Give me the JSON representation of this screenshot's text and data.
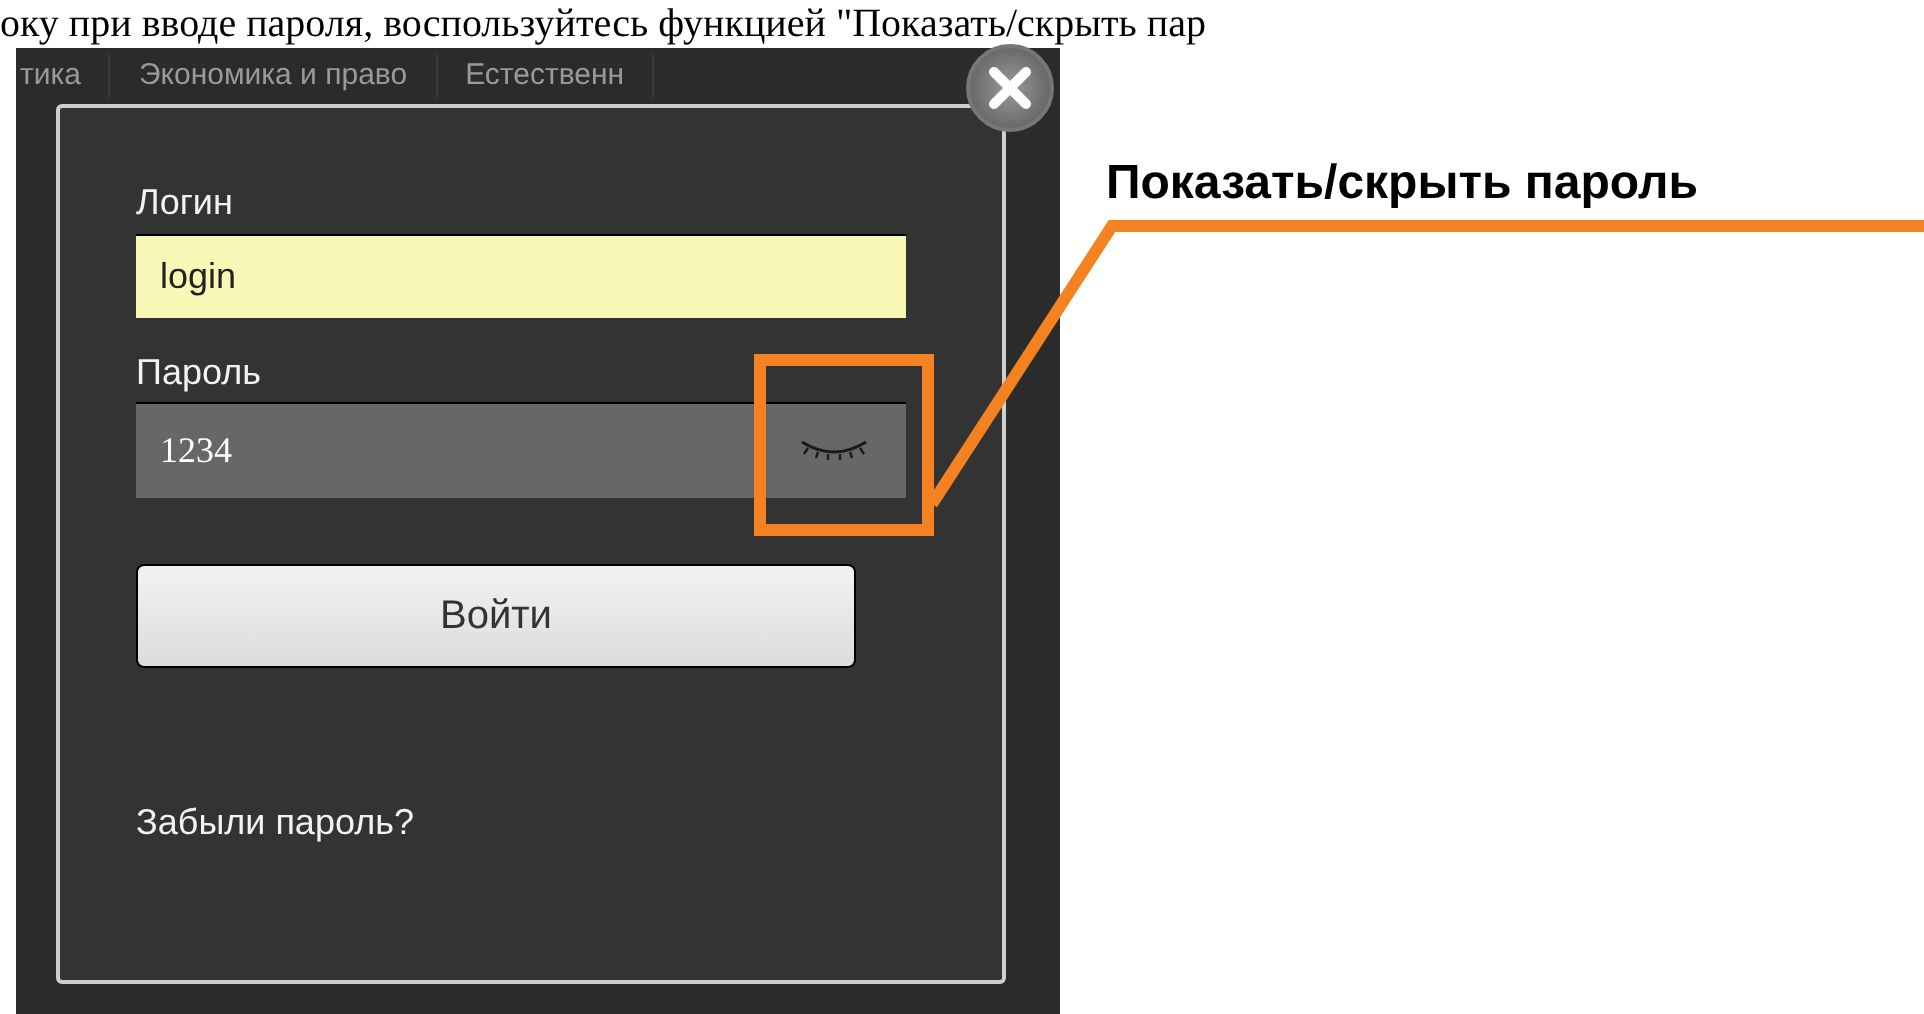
{
  "caption": "оку при вводе пароля, воспользуйтесь функцией \"Показать/скрыть пар",
  "background_tabs": [
    "тика",
    "Экономика и право",
    "Естественн"
  ],
  "dialog": {
    "login_label": "Логин",
    "login_value": "login",
    "password_label": "Пароль",
    "password_value": "1234",
    "submit": "Войти",
    "forgot_link": "Забыли пароль?"
  },
  "callout": "Показать/скрыть пароль"
}
